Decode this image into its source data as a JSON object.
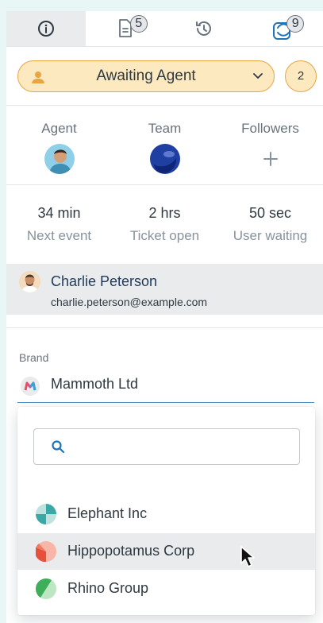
{
  "tabs": [
    {
      "icon": "info-icon",
      "badge": ""
    },
    {
      "icon": "document-icon",
      "badge": "5"
    },
    {
      "icon": "history-icon",
      "badge": ""
    },
    {
      "icon": "apps-icon",
      "badge": "9"
    }
  ],
  "status": {
    "label": "Awaiting Agent",
    "count": "2",
    "color": "#fde9c0",
    "border": "#e7a544"
  },
  "assignees": {
    "agent_label": "Agent",
    "team_label": "Team",
    "followers_label": "Followers"
  },
  "stats": [
    {
      "value": "34 min",
      "caption": "Next event"
    },
    {
      "value": "2 hrs",
      "caption": "Ticket open"
    },
    {
      "value": "50 sec",
      "caption": "User waiting"
    }
  ],
  "requester": {
    "name": "Charlie Peterson",
    "email": "charlie.peterson@example.com"
  },
  "brand": {
    "label": "Brand",
    "value": "Mammoth Ltd",
    "search_placeholder": "",
    "options": [
      {
        "label": "Elephant Inc",
        "hovered": false
      },
      {
        "label": "Hippopotamus Corp",
        "hovered": true
      },
      {
        "label": "Rhino Group",
        "hovered": false
      }
    ]
  },
  "colors": {
    "accent": "#5293c7",
    "selected_row": "#e9ebed"
  }
}
